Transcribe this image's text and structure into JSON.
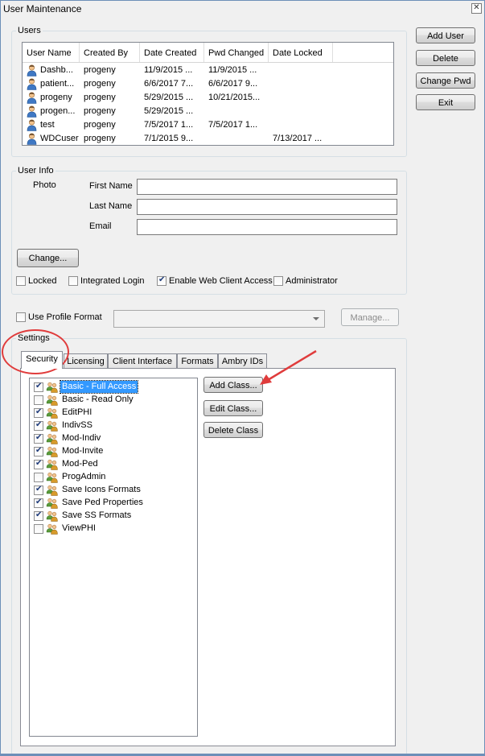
{
  "window": {
    "title": "User Maintenance",
    "close_glyph": "✕"
  },
  "buttons": {
    "add_user": "Add User",
    "delete": "Delete",
    "change_pwd": "Change Pwd",
    "exit": "Exit"
  },
  "users": {
    "group_label": "Users",
    "columns": [
      "User Name",
      "Created By",
      "Date Created",
      "Pwd Changed",
      "Date Locked"
    ],
    "rows": [
      {
        "name": "Dashb...",
        "created_by": "progeny",
        "date_created": "11/9/2015 ...",
        "pwd_changed": "11/9/2015 ...",
        "date_locked": ""
      },
      {
        "name": "patient...",
        "created_by": "progeny",
        "date_created": "6/6/2017 7...",
        "pwd_changed": "6/6/2017 9...",
        "date_locked": ""
      },
      {
        "name": "progeny",
        "created_by": "progeny",
        "date_created": "5/29/2015 ...",
        "pwd_changed": "10/21/2015...",
        "date_locked": ""
      },
      {
        "name": "progen...",
        "created_by": "progeny",
        "date_created": "5/29/2015 ...",
        "pwd_changed": "",
        "date_locked": ""
      },
      {
        "name": "test",
        "created_by": "progeny",
        "date_created": "7/5/2017 1...",
        "pwd_changed": "7/5/2017 1...",
        "date_locked": ""
      },
      {
        "name": "WDCuser",
        "created_by": "progeny",
        "date_created": "7/1/2015 9...",
        "pwd_changed": "",
        "date_locked": "7/13/2017 ..."
      }
    ]
  },
  "user_info": {
    "group_label": "User Info",
    "photo_label": "Photo",
    "first_name_label": "First Name",
    "last_name_label": "Last Name",
    "email_label": "Email",
    "first_name_value": "",
    "last_name_value": "",
    "email_value": "",
    "change_button": "Change...",
    "locked_label": "Locked",
    "integrated_login_label": "Integrated Login",
    "web_access_label": "Enable Web Client Access",
    "administrator_label": "Administrator",
    "locked": false,
    "integrated_login": false,
    "web_access": true,
    "administrator": false
  },
  "profile": {
    "use_profile_format_label": "Use Profile Format",
    "use_profile_format": false,
    "selected_format": "",
    "manage_button": "Manage..."
  },
  "settings": {
    "group_label": "Settings",
    "tabs": [
      "Security",
      "Licensing",
      "Client Interface",
      "Formats",
      "Ambry IDs"
    ],
    "active_tab": "Security",
    "class_buttons": {
      "add": "Add Class...",
      "edit": "Edit Class...",
      "delete": "Delete Class"
    },
    "classes": [
      {
        "label": "Basic - Full Access",
        "checked": true,
        "selected": true
      },
      {
        "label": "Basic - Read Only",
        "checked": false,
        "selected": false
      },
      {
        "label": "EditPHI",
        "checked": true,
        "selected": false
      },
      {
        "label": "IndivSS",
        "checked": true,
        "selected": false
      },
      {
        "label": "Mod-Indiv",
        "checked": true,
        "selected": false
      },
      {
        "label": "Mod-Invite",
        "checked": true,
        "selected": false
      },
      {
        "label": "Mod-Ped",
        "checked": true,
        "selected": false
      },
      {
        "label": "ProgAdmin",
        "checked": false,
        "selected": false
      },
      {
        "label": "Save Icons Formats",
        "checked": true,
        "selected": false
      },
      {
        "label": "Save Ped Properties",
        "checked": true,
        "selected": false
      },
      {
        "label": "Save SS Formats",
        "checked": true,
        "selected": false
      },
      {
        "label": "ViewPHI",
        "checked": false,
        "selected": false
      }
    ]
  },
  "colors": {
    "annotation": "#e03c3c",
    "selection": "#3399ff"
  }
}
